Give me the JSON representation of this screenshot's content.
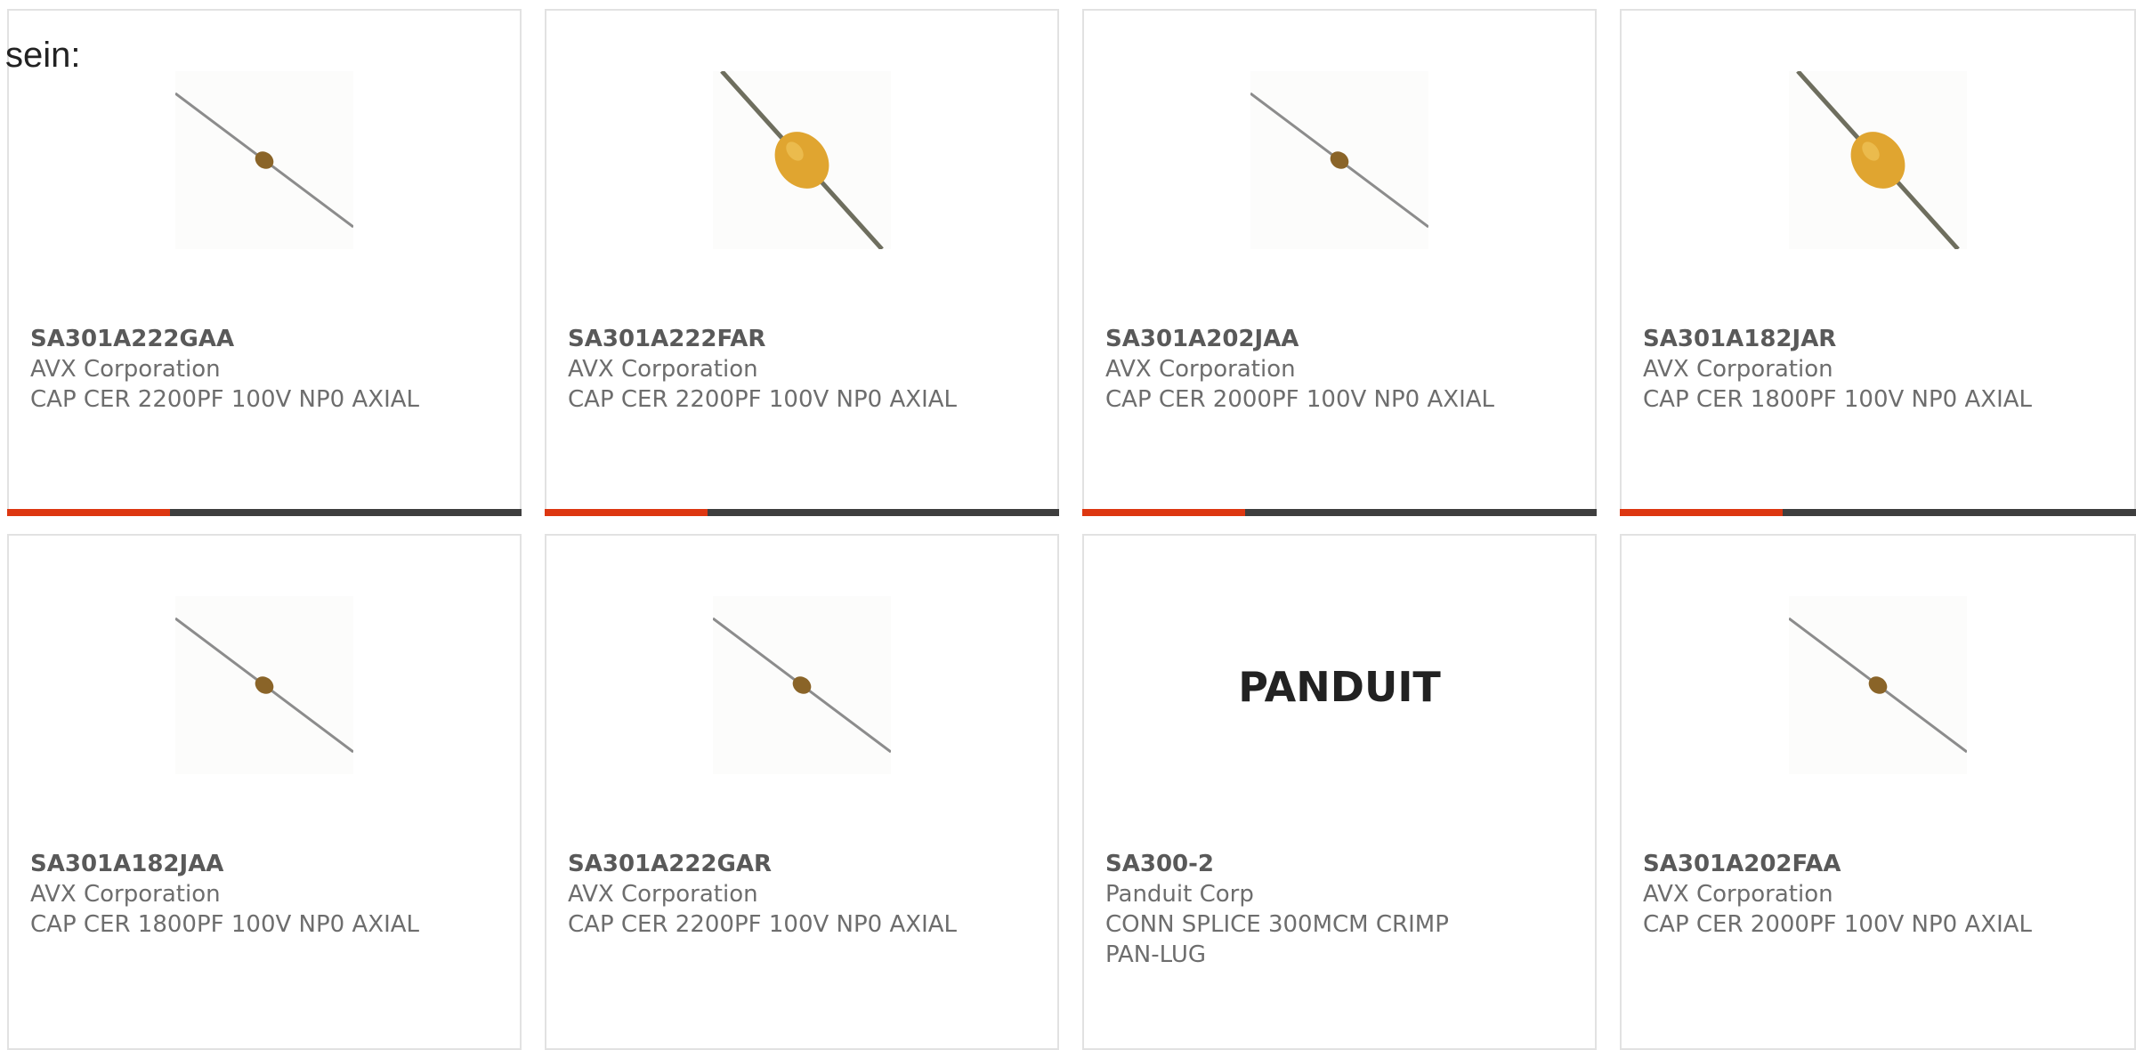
{
  "lead_text": "sein:",
  "colors": {
    "accent": "#dd3711",
    "bar": "#3e3e3e",
    "card_border": "#e2e2e2",
    "part_number": "#595959",
    "text": "#6d6d6d"
  },
  "products": [
    {
      "part_number": "SA301A222GAA",
      "manufacturer": "AVX Corporation",
      "description": "CAP CER 2200PF 100V NP0 AXIAL",
      "image": "capacitor-small-icon"
    },
    {
      "part_number": "SA301A222FAR",
      "manufacturer": "AVX Corporation",
      "description": "CAP CER 2200PF 100V NP0 AXIAL",
      "image": "capacitor-large-icon"
    },
    {
      "part_number": "SA301A202JAA",
      "manufacturer": "AVX Corporation",
      "description": "CAP CER 2000PF 100V NP0 AXIAL",
      "image": "capacitor-small-icon"
    },
    {
      "part_number": "SA301A182JAR",
      "manufacturer": "AVX Corporation",
      "description": "CAP CER 1800PF 100V NP0 AXIAL",
      "image": "capacitor-large-icon"
    },
    {
      "part_number": "SA301A182JAA",
      "manufacturer": "AVX Corporation",
      "description": "CAP CER 1800PF 100V NP0 AXIAL",
      "image": "capacitor-small-icon"
    },
    {
      "part_number": "SA301A222GAR",
      "manufacturer": "AVX Corporation",
      "description": "CAP CER 2200PF 100V NP0 AXIAL",
      "image": "capacitor-small-icon"
    },
    {
      "part_number": "SA300-2",
      "manufacturer": "Panduit Corp",
      "description": "CONN SPLICE 300MCM CRIMP PAN-LUG",
      "image": "panduit-logo",
      "logo_text": "PANDUIT"
    },
    {
      "part_number": "SA301A202FAA",
      "manufacturer": "AVX Corporation",
      "description": "CAP CER 2000PF 100V NP0 AXIAL",
      "image": "capacitor-small-icon"
    }
  ]
}
